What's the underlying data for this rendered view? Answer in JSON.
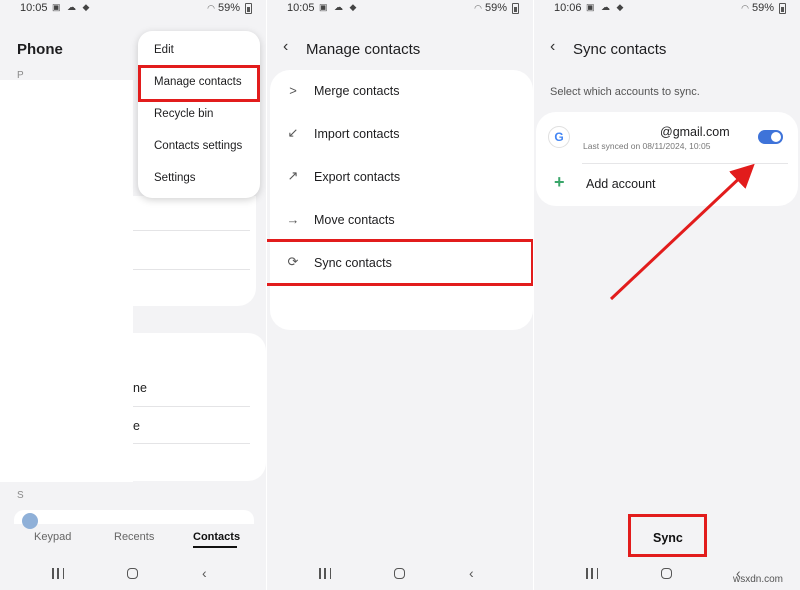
{
  "status_bars": [
    {
      "time": "10:05",
      "battery": "59%"
    },
    {
      "time": "10:05",
      "battery": "59%"
    },
    {
      "time": "10:06",
      "battery": "59%"
    }
  ],
  "panel1": {
    "title": "Phone",
    "index_letters": [
      "P",
      "S"
    ],
    "partial_rows": [
      "ne",
      "e"
    ],
    "menu_items": [
      "Edit",
      "Manage contacts",
      "Recycle bin",
      "Contacts settings",
      "Settings"
    ],
    "bottom_tabs": [
      "Keypad",
      "Recents",
      "Contacts"
    ],
    "active_tab": "Contacts"
  },
  "panel2": {
    "title": "Manage contacts",
    "items": [
      {
        "label": "Merge contacts",
        "icon": "merge-icon"
      },
      {
        "label": "Import contacts",
        "icon": "import-icon"
      },
      {
        "label": "Export contacts",
        "icon": "export-icon"
      },
      {
        "label": "Move contacts",
        "icon": "move-arrow-icon"
      },
      {
        "label": "Sync contacts",
        "icon": "sync-icon"
      }
    ]
  },
  "panel3": {
    "title": "Sync contacts",
    "subtitle": "Select which accounts to sync.",
    "account": {
      "provider_icon": "google-icon",
      "provider_glyph": "G",
      "email": "@gmail.com",
      "last_synced": "Last synced on 08/11/2024, 10:05",
      "enabled": true
    },
    "add_account": "Add account",
    "sync_button": "Sync"
  },
  "watermark": "wsxdn.com",
  "colors": {
    "highlight": "#e21c1c",
    "toggle": "#3e73d9",
    "background": "#f3f3f5",
    "add_icon": "#3aa66a"
  }
}
